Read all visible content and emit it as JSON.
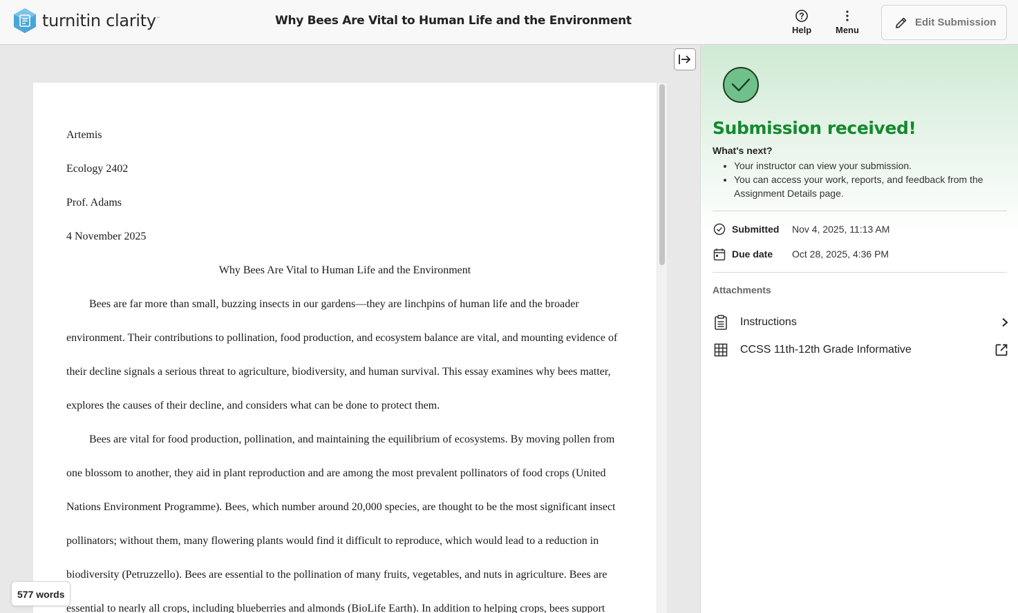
{
  "app": {
    "logo_text": "turnitin clarity",
    "logo_tm": "™"
  },
  "header": {
    "document_title": "Why Bees Are Vital to Human Life and the Environment",
    "help_label": "Help",
    "menu_label": "Menu",
    "edit_label": "Edit Submission"
  },
  "document": {
    "author": "Artemis",
    "course": "Ecology 2402",
    "professor": "Prof. Adams",
    "date": "4 November 2025",
    "title": "Why Bees Are Vital to Human Life and the Environment",
    "paragraphs": [
      "Bees are far more than small, buzzing insects in our gardens—they are linchpins of human life and the broader environment. Their contributions to pollination, food production, and ecosystem balance are vital, and mounting evidence of their decline signals a serious threat to agriculture, biodiversity, and human survival. This essay examines why bees matter, explores the causes of their decline, and considers what can be done to protect them.",
      "Bees are vital for food production, pollination, and maintaining the equilibrium of ecosystems. By moving pollen from one blossom to another, they aid in plant reproduction and are among the most prevalent pollinators of food crops (United Nations Environment Programme). Bees, which number around 20,000 species, are thought to be the most significant insect pollinators; without them, many flowering plants would find it difficult to reproduce, which would lead to a reduction in biodiversity (Petruzzello). Bees are essential to the pollination of many fruits, vegetables, and nuts in agriculture. Bees are essential to nearly all crops, including blueberries and almonds (BioLife Earth). In addition to helping crops, bees support"
    ],
    "word_count": "577 words"
  },
  "panel": {
    "title": "Submission received!",
    "whats_next": "What's next?",
    "next_items": [
      "Your instructor can view your submission.",
      "You can access your work, reports, and feedback from the Assignment Details page."
    ],
    "submitted_label": "Submitted",
    "submitted_value": "Nov 4, 2025, 11:13 AM",
    "due_label": "Due date",
    "due_value": "Oct 28, 2025, 4:36 PM",
    "attachments_header": "Attachments",
    "attachments": [
      {
        "label": "Instructions",
        "icon": "clipboard-icon",
        "trail_icon": "chevron-right-icon"
      },
      {
        "label": "CCSS 11th-12th Grade Informative",
        "icon": "grid-icon",
        "trail_icon": "external-link-icon"
      }
    ]
  },
  "colors": {
    "success_green": "#138a2e",
    "check_fill": "#6fc189",
    "panel_gradient_top": "#cfead4",
    "logo_blue": "#4aa6d8"
  }
}
